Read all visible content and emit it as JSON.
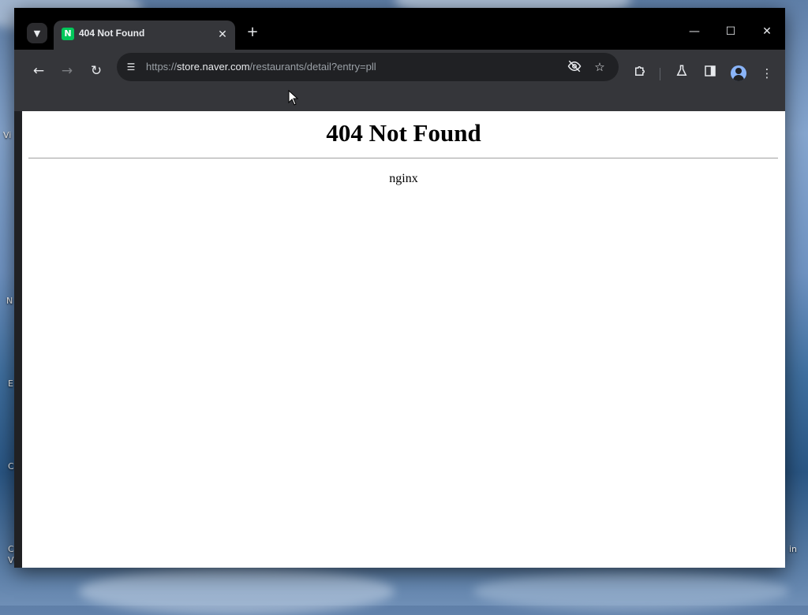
{
  "browser": {
    "tab": {
      "title": "404 Not Found",
      "favicon_letter": "N",
      "favicon_color": "#03c75a"
    },
    "address_bar": {
      "url_scheme": "https://",
      "url_host": "store.naver.com",
      "url_path": "/restaurants/detail?entry=pll"
    },
    "window_controls": {
      "minimize": "—",
      "maximize": "☐",
      "close": "✕"
    }
  },
  "page": {
    "heading": "404 Not Found",
    "server": "nginx"
  },
  "desktop": {
    "labels": [
      "Vi",
      "N",
      "E",
      "C",
      "C",
      "Vi",
      "in"
    ]
  }
}
